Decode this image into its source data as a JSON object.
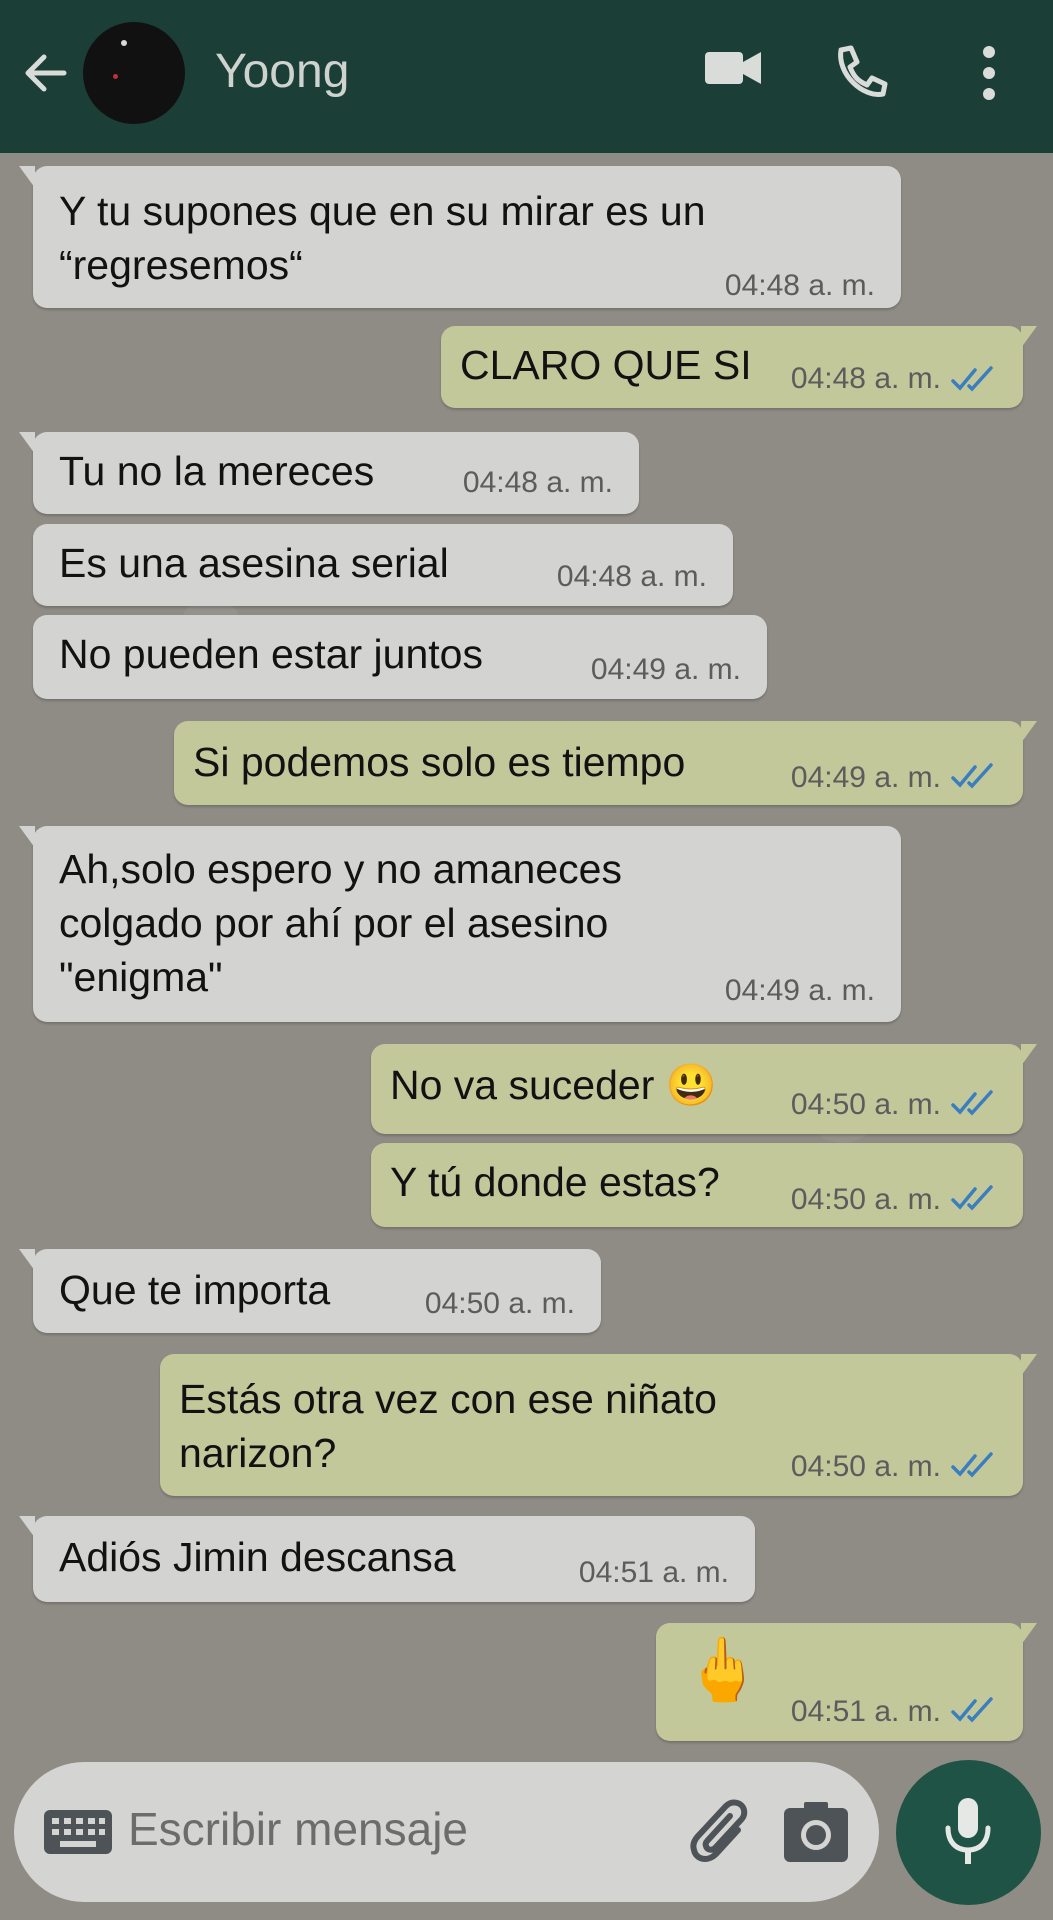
{
  "header": {
    "contact_name": "Yoong",
    "icons": [
      "back-arrow-icon",
      "video-call-icon",
      "voice-call-icon",
      "more-options-icon"
    ]
  },
  "colors": {
    "header_bg": "#1b3f37",
    "incoming_bubble": "#d3d3d1",
    "outgoing_bubble": "#c3c89b",
    "mic_button": "#1e5346",
    "read_ticks": "#3b7ec0"
  },
  "messages": [
    {
      "dir": "in",
      "text": "Y tu supones que en su mirar es un\n“regresemos“",
      "time": "04:48 a. m."
    },
    {
      "dir": "out",
      "text": "CLARO QUE SI",
      "time": "04:48 a. m.",
      "read": true
    },
    {
      "dir": "in",
      "text": "Tu no la mereces",
      "time": "04:48 a. m."
    },
    {
      "dir": "in",
      "text": "Es una asesina serial",
      "time": "04:48 a. m."
    },
    {
      "dir": "in",
      "text": "No pueden estar juntos",
      "time": "04:49 a. m."
    },
    {
      "dir": "out",
      "text": "Si podemos solo es tiempo",
      "time": "04:49 a. m.",
      "read": true
    },
    {
      "dir": "in",
      "text": "Ah,solo espero y no amaneces\ncolgado por ahí por el asesino\n\"enigma\"",
      "time": "04:49 a. m."
    },
    {
      "dir": "out",
      "text": "No va suceder 😃",
      "time": "04:50 a. m.",
      "read": true
    },
    {
      "dir": "out",
      "text": "Y tú donde estas?",
      "time": "04:50 a. m.",
      "read": true
    },
    {
      "dir": "in",
      "text": "Que te importa",
      "time": "04:50 a. m."
    },
    {
      "dir": "out",
      "text": "Estás otra vez con ese niñato\nnarizon?",
      "time": "04:50 a. m.",
      "read": true
    },
    {
      "dir": "in",
      "text": "Adiós Jimin descansa",
      "time": "04:51 a. m."
    },
    {
      "dir": "out",
      "text": "🖕",
      "time": "04:51 a. m.",
      "read": true
    }
  ],
  "composer": {
    "placeholder": "Escribir mensaje",
    "icons": [
      "keyboard-icon",
      "paperclip-icon",
      "camera-icon",
      "microphone-icon"
    ]
  }
}
